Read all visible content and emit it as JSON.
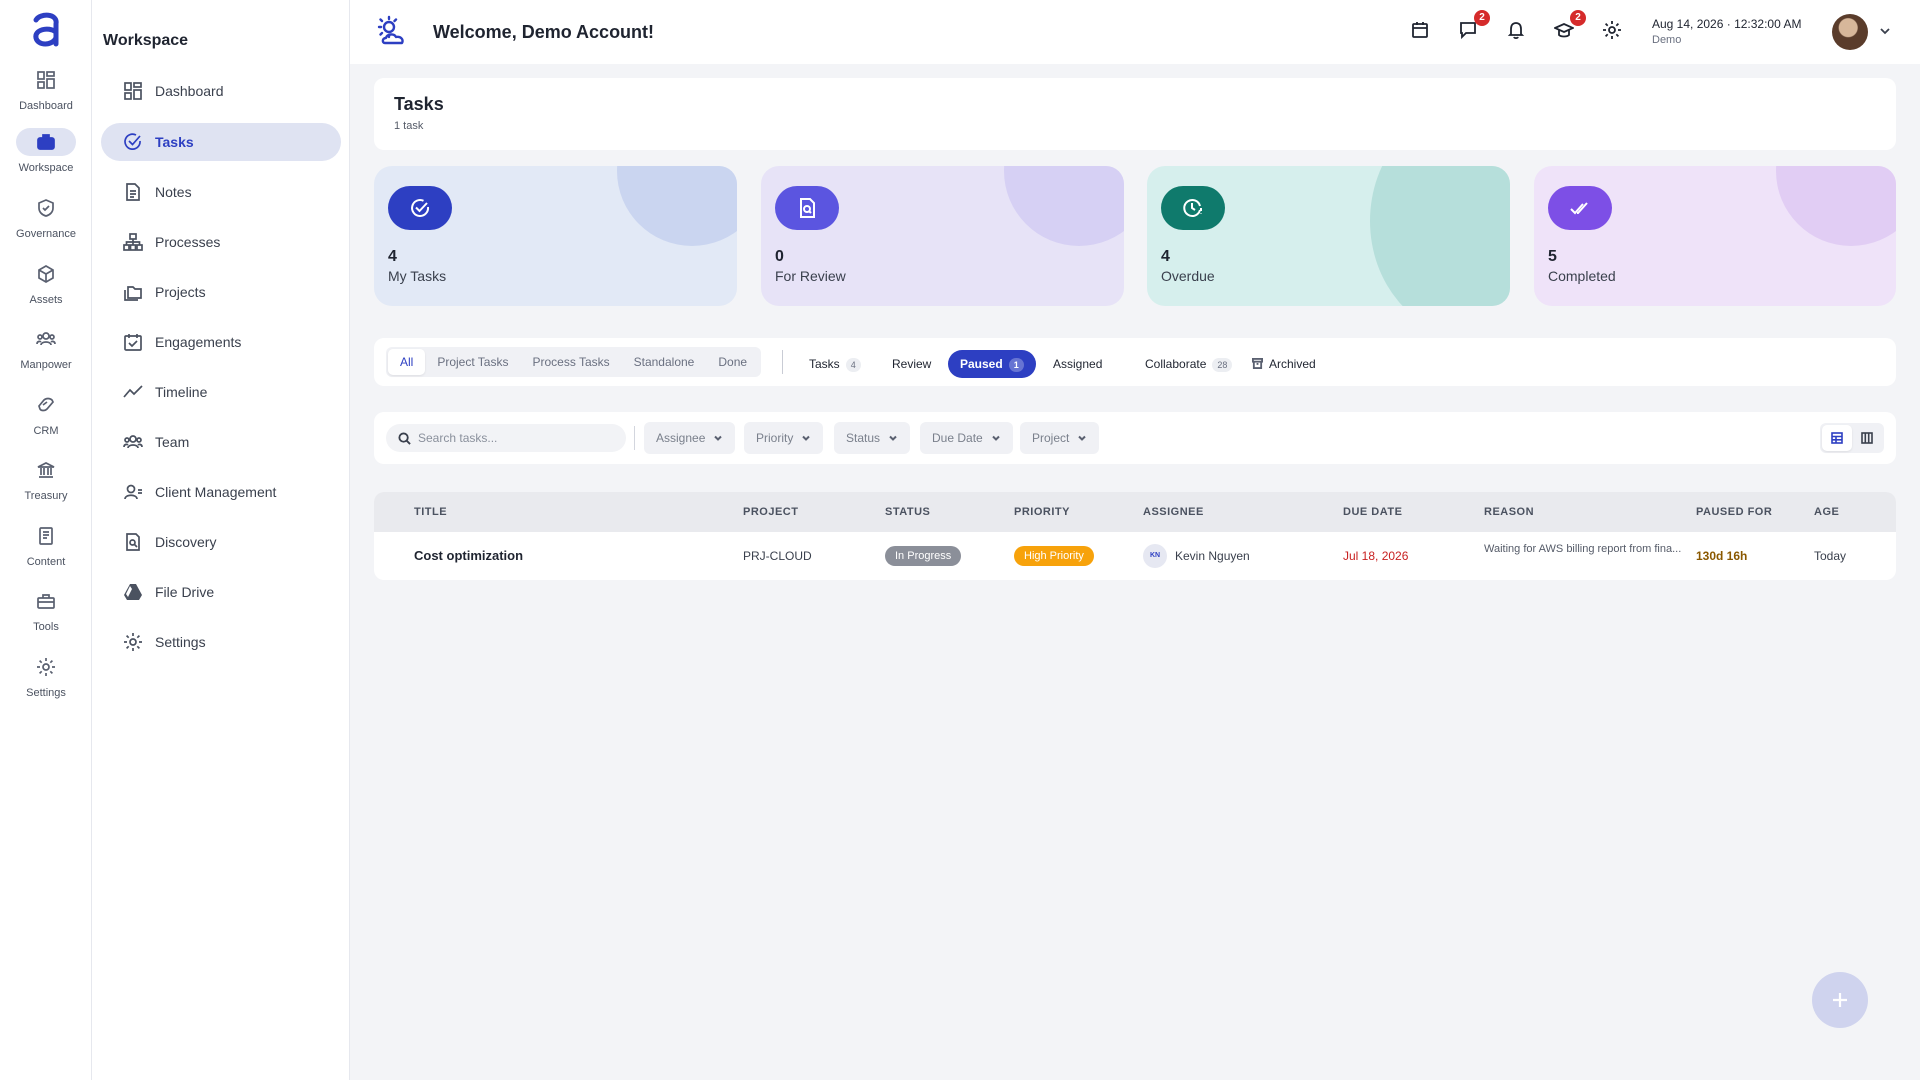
{
  "rail": {
    "items": [
      {
        "label": "Dashboard",
        "icon": "dashboard-icon"
      },
      {
        "label": "Workspace",
        "icon": "briefcase-icon"
      },
      {
        "label": "Governance",
        "icon": "shield-check-icon"
      },
      {
        "label": "Assets",
        "icon": "cube-icon"
      },
      {
        "label": "Manpower",
        "icon": "people-icon"
      },
      {
        "label": "CRM",
        "icon": "handshake-icon"
      },
      {
        "label": "Treasury",
        "icon": "bank-icon"
      },
      {
        "label": "Content",
        "icon": "document-icon"
      },
      {
        "label": "Tools",
        "icon": "toolbox-icon"
      },
      {
        "label": "Settings",
        "icon": "gear-icon"
      }
    ],
    "active": "Workspace"
  },
  "sidebar": {
    "title": "Workspace",
    "items": [
      {
        "label": "Dashboard",
        "icon": "grid-icon"
      },
      {
        "label": "Tasks",
        "icon": "check-circle-icon"
      },
      {
        "label": "Notes",
        "icon": "note-icon"
      },
      {
        "label": "Processes",
        "icon": "hierarchy-icon"
      },
      {
        "label": "Projects",
        "icon": "folders-icon"
      },
      {
        "label": "Engagements",
        "icon": "calendar-check-icon"
      },
      {
        "label": "Timeline",
        "icon": "trend-line-icon"
      },
      {
        "label": "Team",
        "icon": "team-icon"
      },
      {
        "label": "Client Management",
        "icon": "client-icon"
      },
      {
        "label": "Discovery",
        "icon": "search-doc-icon"
      },
      {
        "label": "File Drive",
        "icon": "drive-icon"
      },
      {
        "label": "Settings",
        "icon": "gear-icon"
      }
    ],
    "active": "Tasks"
  },
  "topbar": {
    "welcome": "Welcome, Demo Account!",
    "chat_badge": "2",
    "learning_badge": "2",
    "date": "Aug 14, 2026 · ",
    "time": "12:32:00 AM",
    "org": "Demo"
  },
  "page": {
    "title": "Tasks",
    "subtitle": "1 task"
  },
  "stats": [
    {
      "value": "4",
      "label": "My Tasks",
      "color": "#2d3fc2"
    },
    {
      "value": "0",
      "label": "For Review",
      "color": "#5b55e0"
    },
    {
      "value": "4",
      "label": "Overdue",
      "color": "#0f7a6c"
    },
    {
      "value": "5",
      "label": "Completed",
      "color": "#7d4fe6"
    }
  ],
  "segments": [
    "All",
    "Project Tasks",
    "Process Tasks",
    "Standalone",
    "Done"
  ],
  "tabs": [
    {
      "label": "Tasks",
      "count": "4"
    },
    {
      "label": "Review",
      "count": ""
    },
    {
      "label": "Paused",
      "count": "1"
    },
    {
      "label": "Assigned",
      "count": ""
    },
    {
      "label": "Collaborate",
      "count": "28"
    },
    {
      "label": "Archived",
      "count": ""
    }
  ],
  "filters": {
    "search_placeholder": "Search tasks...",
    "items": [
      "Assignee",
      "Priority",
      "Status",
      "Due Date",
      "Project"
    ]
  },
  "table": {
    "headers": [
      "TITLE",
      "PROJECT",
      "STATUS",
      "PRIORITY",
      "ASSIGNEE",
      "DUE DATE",
      "REASON",
      "PAUSED FOR",
      "AGE"
    ],
    "rows": [
      {
        "title": "Cost optimization",
        "project": "PRJ-CLOUD",
        "status": "In Progress",
        "priority": "High Priority",
        "assignee_initials": "KN",
        "assignee": "Kevin Nguyen",
        "due": "Jul 18, 2026",
        "reason": "Waiting for AWS billing report from fina...",
        "paused_for": "130d 16h",
        "age": "Today"
      }
    ]
  }
}
